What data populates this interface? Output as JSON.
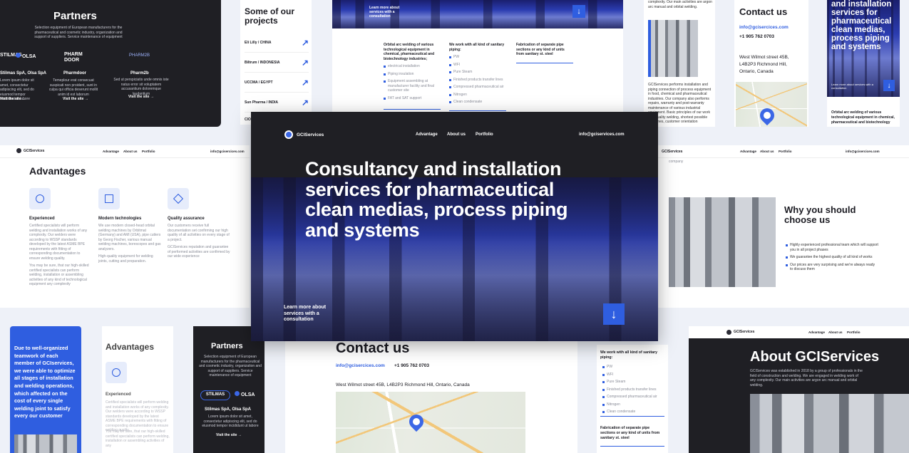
{
  "brand": {
    "name": "GCIServices"
  },
  "nav": {
    "advantage": "Advantage",
    "about": "About us",
    "portfolio": "Portfolio"
  },
  "email": "info@gciservices.com",
  "email_alt": "info@gcisercices.com",
  "phone": "+1 905 762 0703",
  "hero": {
    "title": "Consultancy and installation services for pharmaceutical clean medias, process piping and systems",
    "cta": "Learn more about services with a consultation",
    "cta_short": "Learn more about services with a consultation"
  },
  "partners": {
    "title": "Partners",
    "subtitle": "Selection equipment of European manufacturers for the pharmaceutical and cosmetic industry, organization and support of suppliers. Service maintenance of equipment",
    "logos": [
      "STILMAS",
      "OLSA",
      "PHARM DOOR",
      "PHARM2B"
    ],
    "items": [
      {
        "name": "Stilmas SpA, Olsa SpA",
        "desc": "Lorem ipsum dolor sit amet, consectetur adipiscing elit, sed do eiusmod tempor incididunt ut labore",
        "link": "Visit the site"
      },
      {
        "name": "Pharmdoor",
        "desc": "Temeplour erat consecuat suspicati non proident, sunt in culpa qui officia deserunt mollit anim id est laborum",
        "link": "Visit the site"
      },
      {
        "name": "Pharm2b",
        "desc": "Sed ut perspiciatis unde omnis iste natus error sit voluptatem accusantium doloremque laudantium",
        "link": "Visit the site"
      }
    ],
    "mobile_item": {
      "name": "Stilmas SpA, Olsa SpA",
      "desc": "Lorem ipsum dolor sit amet, consectetur adipiscing elit, sed do eiusmod tempor incididunt ut labore",
      "link": "Visit the site"
    }
  },
  "projects": {
    "title": "Some of our projects",
    "items": [
      "Eli Lilly / CHINA",
      "Biltrum / INDONESIA",
      "UCCMA / EGYPT",
      "Sun Pharma / INDIA",
      "CIO"
    ]
  },
  "services_cols": [
    {
      "title": "Orbital arc welding of various technological equipment in chemical, pharmaceutical and biotechnology industries;",
      "items": [
        "electrical installation",
        "Piping insulation",
        "Equipment assembling at manufacturer facility and final customer site",
        "FAT and SAT support"
      ]
    },
    {
      "title": "We work with all kind of sanitary piping:",
      "items": [
        "PW",
        "WFI",
        "Pure Steam",
        "Finished products transfer lines",
        "Compressed pharmaceutical air",
        "Nitrogen",
        "Clean condensate"
      ]
    },
    {
      "title": "Fabrication of separate pipe sections or any kind of units from sanitary st. steel",
      "items": []
    }
  ],
  "contact": {
    "title": "Contact us",
    "address": "West Wilmot street 45B, L4B2P3 Richmond Hill, Ontario, Canada",
    "address_lines": [
      "West Wilmot street 45B,",
      "L4B2P3 Richmond Hill,",
      "Ontario, Canada"
    ]
  },
  "about_snippet": {
    "top": "complexity. Our main activities are argon arc manual and orbital welding.",
    "body": "GCIServices performs installation and piping connection of process equipment in food, chemical and pharmaceutical industries. Our company also performs repairs, warranty and post-warranty maintenance of various industrial equipment. Basic principles of our work are: quality welding, shortest possible deadlines, customer orientation"
  },
  "mobile_hero": {
    "title": "and installation services for pharmaceutical clean medias, process piping and systems",
    "cta": "Learn more about services with a consultation",
    "under": "Orbital arc welding of various technological equipment in chemical, pharmaceutical and biotechnology"
  },
  "advantages": {
    "title": "Advantages",
    "items": [
      {
        "title": "Experienced",
        "desc": "Certified specialists will perform welding and installation works of any complexity. Our welders were according to WSSP standards developed by the latest ASME BPE requirements with fitting of corresponding documentation to ensure welding quality.",
        "extra": "You may be sure, that our high-skilled certified specialists can perform welding, installation or assembling activities of any kind of technological equipment any complexity"
      },
      {
        "title": "Modern technologies",
        "desc": "We use modern closed-head orbital welding machines by Orbitmat (Germany) and AMI (USA), pipe cutters by Georg Fischer, various manual welding machines, borescopes and gas analyzers.",
        "extra": "High-quality equipment for welding joints, cutting and preparation."
      },
      {
        "title": "Quality assurance",
        "desc": "Our customers receive full documentation set confirming our high quality of all activities on every stage of a project.",
        "extra": "GCIServices reputation and guarantee of performed activities are confirmed by our wide experience"
      }
    ],
    "mobile_item": {
      "title": "Experienced",
      "desc": "Certified specialists will perform welding and installation works of any complexity. Our welders were according to WSSP standards developed by the latest ASME BPE requirements with fitting of corresponding documentation to ensure welding quality.",
      "extra": "You may be sure, that our high-skilled certified specialists can perform welding, installation or assembling activities of any"
    }
  },
  "why": {
    "title": "Why you should choose us",
    "top": "company",
    "items": [
      "Highly experienced professional team which will support you in all project phases",
      "We guarantee the highest quality of all kind of works",
      "Our prices are very surprising and we're always ready to discuss them"
    ]
  },
  "blue_card": {
    "text": "Due to well-organized teamwork of each member of GCIservices, we were able to optimize all stages of installation and welding operations, which affected on the cost of every single welding joint to satisfy every our customer"
  },
  "sanitary_mobile": {
    "title": "We work with all kind of sanitary piping:",
    "items": [
      "PW",
      "WFI",
      "Pure Steam",
      "Finished products transfer lines",
      "Compressed pharmaceutical air",
      "Nitrogen",
      "Clean condensate"
    ],
    "fab": "Fabrication of separate pipe sections or any kind of units from sanitary st. steel"
  },
  "about": {
    "title": "About GCIServices",
    "text": "GCIServices was established in 2018 by a group of professionals in the field of construction and welding. We are engaged in welding work of any complexity. Our main activities are argon arc manual and orbital welding."
  },
  "icons": {
    "arrow_down": "↓",
    "arrow_ne": "↗",
    "arrow_right": "→"
  },
  "colors": {
    "accent": "#2f5ee0",
    "dark": "#1f1f24",
    "background": "#eef1f8"
  }
}
